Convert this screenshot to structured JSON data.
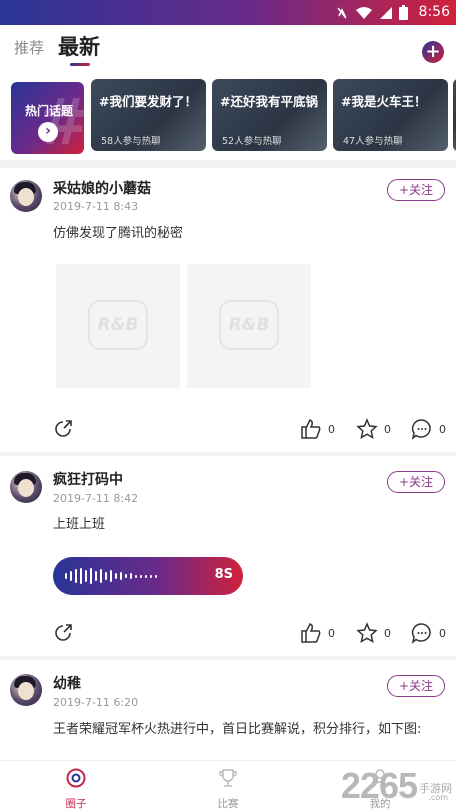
{
  "status_bar": {
    "time": "8:56"
  },
  "header": {
    "tab_recommend": "推荐",
    "tab_latest": "最新"
  },
  "topics": {
    "hot_title": "热门话题",
    "cards": [
      {
        "title": "#我们要发财了！",
        "count": "58人参与热聊"
      },
      {
        "title": "#还好我有平底锅",
        "count": "52人参与热聊"
      },
      {
        "title": "#我是火车王！",
        "count": "47人参与热聊"
      }
    ]
  },
  "posts": [
    {
      "username": "采姑娘的小蘑菇",
      "date": "2019-7-11 8:43",
      "follow_label": "+关注",
      "content": "仿佛发现了腾讯的秘密",
      "image_logo": "R&B",
      "likes": "0",
      "favorites": "0",
      "comments": "0"
    },
    {
      "username": "疯狂打码中",
      "date": "2019-7-11 8:42",
      "follow_label": "+关注",
      "content": "上班上班",
      "voice_duration": "8S",
      "likes": "0",
      "favorites": "0",
      "comments": "0"
    },
    {
      "username": "幼稚",
      "date": "2019-7-11 6:20",
      "follow_label": "+关注",
      "content": "王者荣耀冠军杯火热进行中，首日比赛解说，积分排行，如下图:"
    }
  ],
  "bottom_nav": {
    "items": [
      {
        "label": "圈子"
      },
      {
        "label": "比赛"
      },
      {
        "label": "我的"
      }
    ]
  },
  "watermark": {
    "brand": "2265",
    "suffix": "手游网",
    "domain": ".com"
  },
  "colors": {
    "brand_blue": "#2a3596",
    "brand_red": "#d0213a",
    "follow_purple": "#8a3a8a"
  }
}
